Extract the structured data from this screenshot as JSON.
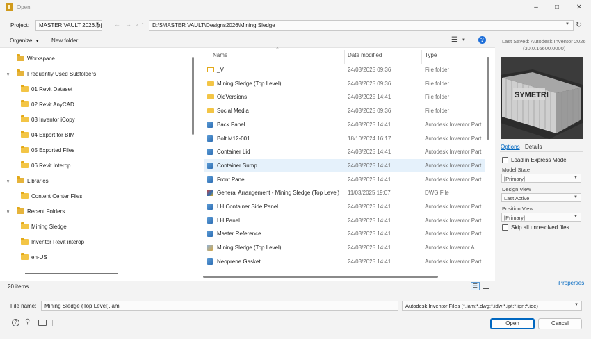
{
  "window": {
    "title": "Open",
    "controls": [
      "minimize-icon",
      "maximize-icon",
      "close-icon"
    ]
  },
  "project": {
    "label": "Project:",
    "value": "MASTER VAULT 2026.ipj"
  },
  "address": {
    "path": "D:\\$MASTER VAULT\\Designs2026\\Mining Sledge"
  },
  "toolbar": {
    "organize": "Organize",
    "new_folder": "New folder"
  },
  "nav": {
    "workspace": "Workspace",
    "frequent": "Frequently Used Subfolders",
    "frequent_items": [
      "01 Revit Dataset",
      "02 Revit AnyCAD",
      "03 Inventor iCopy",
      "04 Export for BIM",
      "05 Exported Files",
      "06 Revit Interop"
    ],
    "libraries": "Libraries",
    "library_items": [
      "Content Center Files"
    ],
    "recent": "Recent Folders",
    "recent_items": [
      "Mining Sledge",
      "Inventor Revit interop",
      "en-US"
    ]
  },
  "columns": {
    "name": "Name",
    "date": "Date modified",
    "type": "Type"
  },
  "files": [
    {
      "name": "_V",
      "date": "24/03/2025 09:36",
      "type": "File folder",
      "icon": "folder-outline-icon"
    },
    {
      "name": "Mining Sledge (Top Level)",
      "date": "24/03/2025 09:36",
      "type": "File folder",
      "icon": "folder-icon"
    },
    {
      "name": "OldVersions",
      "date": "24/03/2025 14:41",
      "type": "File folder",
      "icon": "folder-icon"
    },
    {
      "name": "Social Media",
      "date": "24/03/2025 09:36",
      "type": "File folder",
      "icon": "folder-icon"
    },
    {
      "name": "Back Panel",
      "date": "24/03/2025 14:41",
      "type": "Autodesk Inventor Part",
      "icon": "part-icon"
    },
    {
      "name": "Bolt M12-001",
      "date": "18/10/2024 16:17",
      "type": "Autodesk Inventor Part",
      "icon": "part-icon"
    },
    {
      "name": "Container Lid",
      "date": "24/03/2025 14:41",
      "type": "Autodesk Inventor Part",
      "icon": "part-icon"
    },
    {
      "name": "Container Sump",
      "date": "24/03/2025 14:41",
      "type": "Autodesk Inventor Part",
      "icon": "part-icon"
    },
    {
      "name": "Front Panel",
      "date": "24/03/2025 14:41",
      "type": "Autodesk Inventor Part",
      "icon": "part-icon"
    },
    {
      "name": "General Arrangement - Mining Sledge (Top Level)",
      "date": "11/03/2025 19:07",
      "type": "DWG File",
      "icon": "dwg-icon"
    },
    {
      "name": "LH Container Side Panel",
      "date": "24/03/2025 14:41",
      "type": "Autodesk Inventor Part",
      "icon": "part-icon"
    },
    {
      "name": "LH Panel",
      "date": "24/03/2025 14:41",
      "type": "Autodesk Inventor Part",
      "icon": "part-icon"
    },
    {
      "name": "Master Reference",
      "date": "24/03/2025 14:41",
      "type": "Autodesk Inventor Part",
      "icon": "part-icon"
    },
    {
      "name": "Mining Sledge (Top Level)",
      "date": "24/03/2025 14:41",
      "type": "Autodesk Inventor A...",
      "icon": "assembly-icon"
    },
    {
      "name": "Neoprene Gasket",
      "date": "24/03/2025 14:41",
      "type": "Autodesk Inventor Part",
      "icon": "part-icon"
    }
  ],
  "selected_row": 7,
  "status": {
    "count": "20 items"
  },
  "right_panel": {
    "last_saved": "Last Saved: Autodesk Inventor 2026",
    "version": "(30.0.16600.0000)",
    "preview_text": "SYMETRI",
    "tab_options": "Options",
    "tab_details": "Details",
    "express_mode": "Load in Express Mode",
    "model_state_label": "Model State",
    "model_state_value": "[Primary]",
    "design_view_label": "Design View",
    "design_view_value": "Last Active",
    "position_view_label": "Position View",
    "position_view_value": "[Primary]",
    "skip_unresolved": "Skip all unresolved files",
    "iproperties": "iProperties"
  },
  "bottom": {
    "filename_label": "File name:",
    "filename_value": "Mining Sledge (Top Level).iam",
    "filter_value": "Autodesk Inventor Files (*.iam;*.dwg;*.idw;*.ipt;*.ipn;*.ide)",
    "open": "Open",
    "cancel": "Cancel"
  },
  "colors": {
    "accent": "#0067c0",
    "selection": "#e5f1fb",
    "folder": "#f3c546"
  }
}
